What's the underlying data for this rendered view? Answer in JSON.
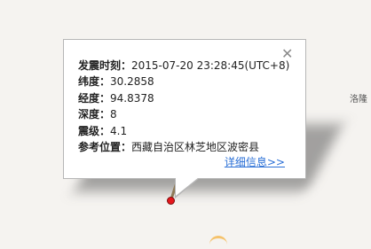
{
  "map": {
    "place_label": "洛隆",
    "colors": {
      "background": "#f5f3f0",
      "marker": "#e6171c",
      "road": "#f5c26b"
    }
  },
  "popup": {
    "close_icon": "close-icon",
    "rows": [
      {
        "label": "发震时刻：",
        "value": "2015-07-20 23:28:45(UTC+8)"
      },
      {
        "label": "纬度：",
        "value": "30.2858"
      },
      {
        "label": "经度：",
        "value": "94.8378"
      },
      {
        "label": "深度：",
        "value": "8"
      },
      {
        "label": "震级：",
        "value": "4.1"
      },
      {
        "label": "参考位置：",
        "value": "西藏自治区林芝地区波密县"
      }
    ],
    "more_link": "详细信息>>",
    "link_color": "#2a6fd6"
  }
}
